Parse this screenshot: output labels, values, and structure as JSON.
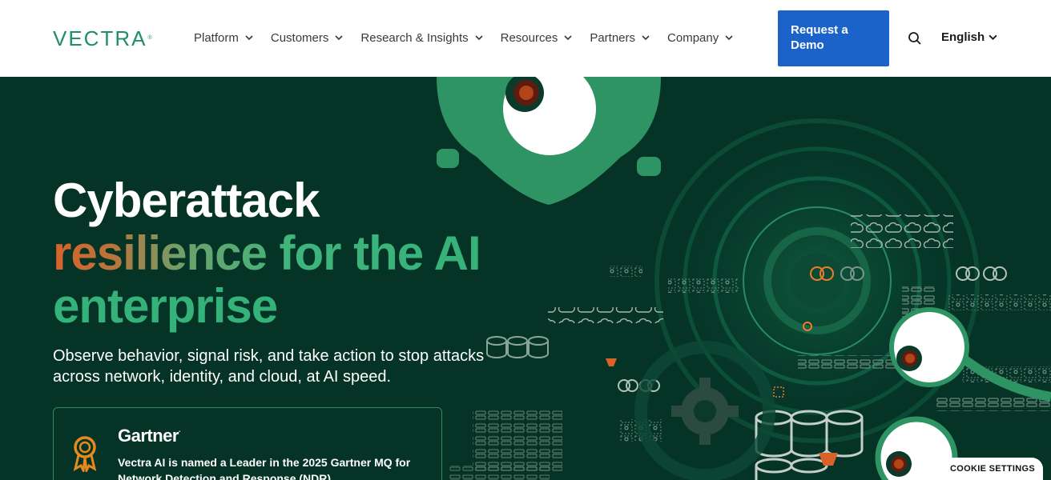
{
  "brand": {
    "name": "VECTRA",
    "mark": "®"
  },
  "nav": [
    {
      "label": "Platform"
    },
    {
      "label": "Customers"
    },
    {
      "label": "Research & Insights"
    },
    {
      "label": "Resources"
    },
    {
      "label": "Partners"
    },
    {
      "label": "Company"
    }
  ],
  "cta": {
    "label": "Request a Demo"
  },
  "language": {
    "label": "English"
  },
  "hero": {
    "line1": "Cyberattack",
    "line2": "resilience for the AI",
    "line3": "enterprise",
    "subtitle": "Observe behavior, signal risk, and take action to stop attacks across network, identity, and cloud, at AI speed."
  },
  "award_card": {
    "vendor": "Gartner",
    "vendor_mark": ".",
    "text": "Vectra AI is named a Leader in the 2025 Gartner MQ for Network Detection and Response (NDR)"
  },
  "cookie": {
    "label": "COOKIE SETTINGS"
  },
  "colors": {
    "brand_green": "#1f8f68",
    "hero_bg": "#053326",
    "accent_green": "#35b27a",
    "accent_orange": "#d9622b",
    "cta_blue": "#1b63c9"
  }
}
